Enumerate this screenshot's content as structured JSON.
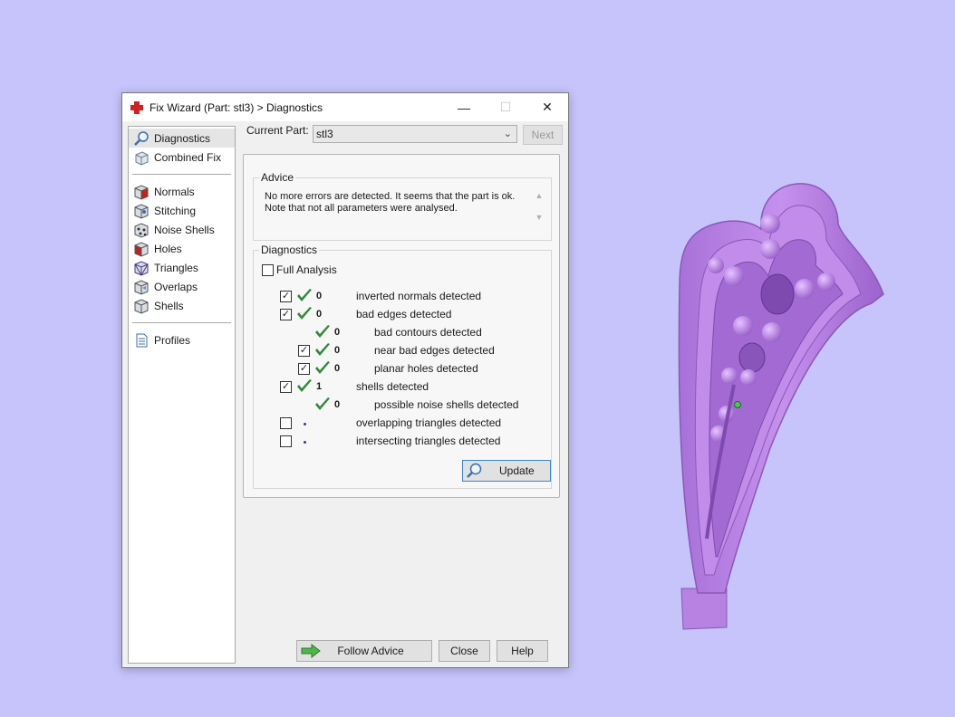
{
  "window": {
    "title": "Fix Wizard (Part: stl3) > Diagnostics",
    "minimize": "—",
    "maximize": "☐",
    "close": "✕"
  },
  "sidebar": {
    "items": [
      {
        "label": "Diagnostics",
        "icon": "magnifier-icon"
      },
      {
        "label": "Combined Fix",
        "icon": "combined-fix-icon"
      },
      {
        "label": "Normals",
        "icon": "normals-cube-icon"
      },
      {
        "label": "Stitching",
        "icon": "stitching-cube-icon"
      },
      {
        "label": "Noise Shells",
        "icon": "noise-shells-cube-icon"
      },
      {
        "label": "Holes",
        "icon": "holes-cube-icon"
      },
      {
        "label": "Triangles",
        "icon": "triangles-cube-icon"
      },
      {
        "label": "Overlaps",
        "icon": "overlaps-cube-icon"
      },
      {
        "label": "Shells",
        "icon": "shells-cube-icon"
      },
      {
        "label": "Profiles",
        "icon": "profiles-document-icon"
      }
    ]
  },
  "header": {
    "current_part_label": "Current Part:",
    "current_part_value": "stl3",
    "next_label": "Next"
  },
  "advice": {
    "title": "Advice",
    "line1": "No more errors are detected. It seems that the part is ok.",
    "line2": "Note that not all parameters were analysed."
  },
  "diagnostics": {
    "title": "Diagnostics",
    "full_analysis_label": "Full Analysis",
    "full_analysis_checked": false,
    "rows": [
      {
        "checked": true,
        "status": "ok",
        "count": "0",
        "label": "inverted normals detected"
      },
      {
        "checked": true,
        "status": "ok",
        "count": "0",
        "label": "bad edges detected"
      },
      {
        "checked": null,
        "status": "ok",
        "count": "0",
        "label": "bad contours detected"
      },
      {
        "checked": true,
        "status": "ok",
        "count": "0",
        "label": "near bad edges detected"
      },
      {
        "checked": true,
        "status": "ok",
        "count": "0",
        "label": "planar holes detected"
      },
      {
        "checked": true,
        "status": "ok",
        "count": "1",
        "label": "shells detected"
      },
      {
        "checked": null,
        "status": "ok",
        "count": "0",
        "label": "possible noise shells detected"
      },
      {
        "checked": false,
        "status": "none",
        "count": "",
        "label": "overlapping triangles detected"
      },
      {
        "checked": false,
        "status": "none",
        "count": "",
        "label": "intersecting triangles detected"
      }
    ],
    "update_label": "Update"
  },
  "footer": {
    "follow_advice_label": "Follow Advice",
    "close_label": "Close",
    "help_label": "Help"
  },
  "colors": {
    "background": "#c6c4fb",
    "model": "#b77fe0",
    "check_green": "#2e8b3a"
  }
}
